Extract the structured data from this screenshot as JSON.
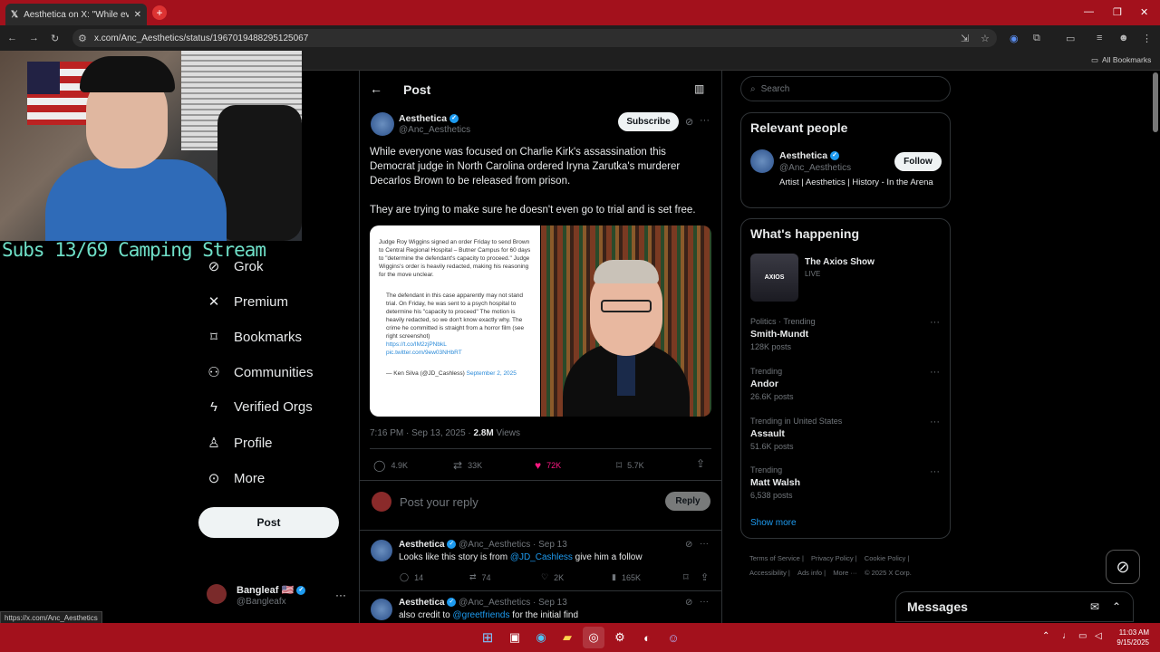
{
  "browser": {
    "tab_title": "Aesthetica on X: \"While everyo",
    "url": "x.com/Anc_Aesthetics/status/1967019488295125067",
    "all_bookmarks": "All Bookmarks",
    "status_url": "https://x.com/Anc_Aesthetics"
  },
  "stream": {
    "caption": "Subs 13/69 Camping Stream"
  },
  "nav": {
    "items": [
      {
        "label": "Grok",
        "icon": "grok-icon"
      },
      {
        "label": "Premium",
        "icon": "x-logo-icon"
      },
      {
        "label": "Bookmarks",
        "icon": "bookmark-icon"
      },
      {
        "label": "Communities",
        "icon": "communities-icon"
      },
      {
        "label": "Verified Orgs",
        "icon": "lightning-icon"
      },
      {
        "label": "Profile",
        "icon": "person-icon"
      },
      {
        "label": "More",
        "icon": "more-circle-icon"
      }
    ],
    "post_button": "Post",
    "account": {
      "name": "Bangleaf 🇺🇸",
      "handle": "@Bangleafx"
    }
  },
  "post": {
    "header_title": "Post",
    "author": {
      "name": "Aesthetica",
      "handle": "@Anc_Aesthetics"
    },
    "subscribe_label": "Subscribe",
    "text_p1": "While everyone was focused on Charlie Kirk's assassination this Democrat judge in North Carolina ordered Iryna Zarutka's murderer Decarlos Brown to be released from prison.",
    "text_p2": "They are trying to make sure he doesn't even go to trial and is set free.",
    "image_left": {
      "para1": "Judge Roy Wiggins signed an order Friday to send Brown to Central Regional Hospital – Butner Campus for 60 days to \"determine the defendant's capacity to proceed.\" Judge Wiggins's order is heavily redacted, making his reasoning for the move unclear.",
      "quote": "The defendant in this case apparently may not stand trial. On Friday, he was sent to a psych hospital to determine his \"capacity to proceed\" The motion is heavily redacted, so we don't know exactly why. The crime he committed is straight from a horror film (see right screenshot)",
      "link1": "https://t.co/IM2zjPNbkL",
      "link2": "pic.twitter.com/9ew03NHbRT",
      "attribution": "— Ken Silva (@JD_Cashless)",
      "date": "September 2, 2025"
    },
    "timestamp": "7:16 PM · Sep 13, 2025 · ",
    "views_count": "2.8M",
    "views_label": " Views",
    "stats": {
      "replies": "4.9K",
      "reposts": "33K",
      "likes": "72K",
      "bookmarks": "5.7K"
    },
    "reply_placeholder": "Post your reply",
    "reply_button": "Reply"
  },
  "replies": [
    {
      "name": "Aesthetica",
      "handle": "@Anc_Aesthetics",
      "date": "· Sep 13",
      "text_before": "Looks like this story is from ",
      "mention": "@JD_Cashless",
      "text_after": " give him a follow",
      "stats": {
        "replies": "14",
        "reposts": "74",
        "likes": "2K",
        "views": "165K"
      }
    },
    {
      "name": "Aesthetica",
      "handle": "@Anc_Aesthetics",
      "date": "· Sep 13",
      "text_before": "also credit to ",
      "mention": "@greetfriends",
      "text_after": " for the initial find"
    }
  ],
  "sidebar": {
    "search_placeholder": "Search",
    "relevant_title": "Relevant people",
    "person": {
      "name": "Aesthetica",
      "handle": "@Anc_Aesthetics",
      "bio": "Artist | Aesthetics | History - In the Arena",
      "follow": "Follow"
    },
    "happening_title": "What's happening",
    "live": {
      "title": "The Axios Show",
      "status": "LIVE",
      "thumb_label": "AXIOS"
    },
    "trends": [
      {
        "meta": "Politics · Trending",
        "title": "Smith-Mundt",
        "count": "128K posts"
      },
      {
        "meta": "Trending",
        "title": "Andor",
        "count": "26.6K posts"
      },
      {
        "meta": "Trending in United States",
        "title": "Assault",
        "count": "51.6K posts"
      },
      {
        "meta": "Trending",
        "title": "Matt Walsh",
        "count": "6,538 posts"
      }
    ],
    "show_more": "Show more",
    "footer": [
      "Terms of Service",
      "Privacy Policy",
      "Cookie Policy",
      "Accessibility",
      "Ads info",
      "More ···",
      "© 2025 X Corp."
    ]
  },
  "messages": {
    "title": "Messages"
  },
  "taskbar": {
    "time": "11:03 AM",
    "date": "9/15/2025"
  },
  "colors": {
    "chrome_red": "#a3111c",
    "x_blue": "#1d9bf0",
    "like_pink": "#f91880"
  }
}
